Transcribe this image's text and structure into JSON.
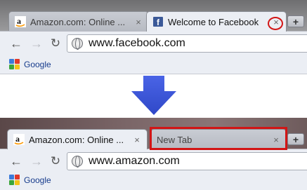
{
  "before": {
    "tabs": [
      {
        "label": "Amazon.com: Online ...",
        "close": "×",
        "icon": "amazon-favicon"
      },
      {
        "label": "Welcome to Facebook",
        "close": "×",
        "icon": "facebook-favicon"
      }
    ],
    "new_tab": "+",
    "back": "←",
    "forward": "→",
    "reload": "↻",
    "url": "www.facebook.com",
    "bookmark": "Google"
  },
  "after": {
    "tabs": [
      {
        "label": "Amazon.com: Online ...",
        "close": "×",
        "icon": "amazon-favicon"
      },
      {
        "label": "New Tab",
        "close": "×"
      }
    ],
    "new_tab": "+",
    "back": "←",
    "forward": "→",
    "reload": "↻",
    "url": "www.amazon.com",
    "bookmark": "Google"
  },
  "colors": {
    "highlight": "#d21515",
    "arrow": "#3a55d8",
    "facebook": "#3b5998",
    "amazon_orange": "#f90"
  },
  "arrow_icon": "down-arrow-icon"
}
